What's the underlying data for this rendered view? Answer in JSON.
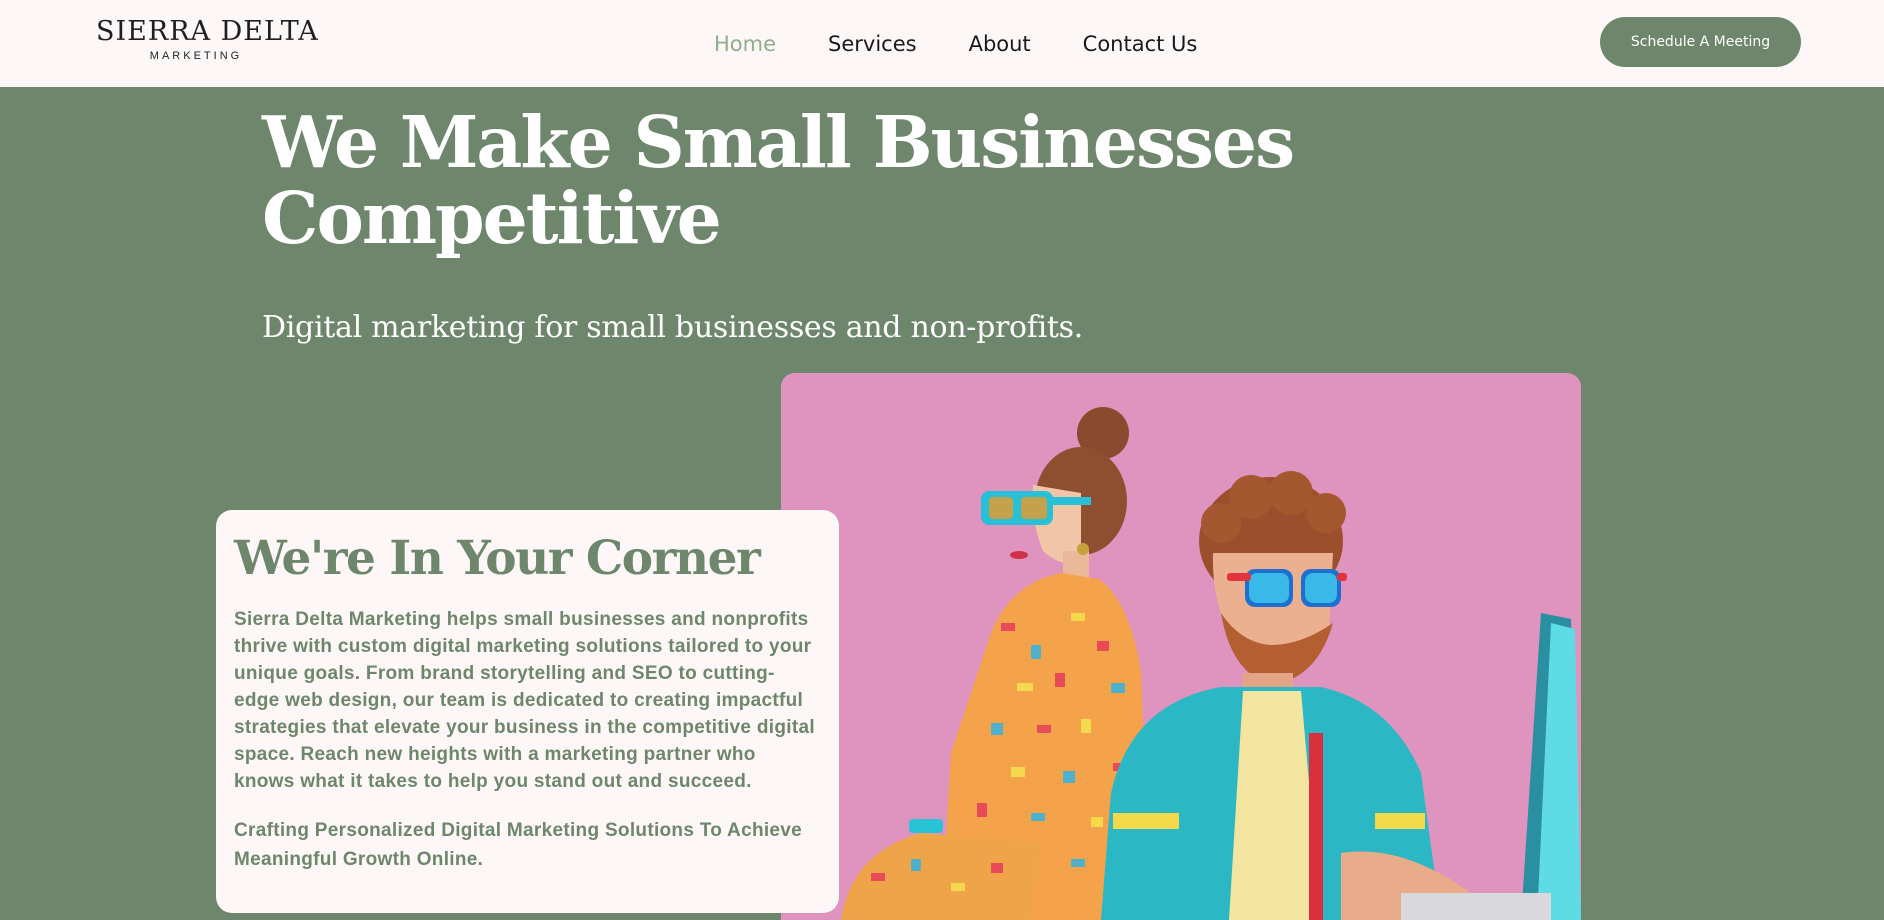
{
  "brand": {
    "logo_main": "SIERRA DELTA",
    "logo_sub": "MARKETING"
  },
  "nav": {
    "items": [
      {
        "label": "Home",
        "active": true
      },
      {
        "label": "Services",
        "active": false
      },
      {
        "label": "About",
        "active": false
      },
      {
        "label": "Contact Us",
        "active": false
      }
    ]
  },
  "header": {
    "cta_label": "Schedule A Meeting"
  },
  "hero": {
    "title": "We Make Small Businesses Competitive",
    "subtitle": "Digital marketing for small businesses and non-profits."
  },
  "card": {
    "heading": "We're In Your Corner",
    "body": "Sierra Delta Marketing helps small businesses and nonprofits thrive with custom digital marketing solutions tailored to your unique goals. From brand storytelling and SEO to cutting-edge web design, our team is dedicated to creating impactful strategies that elevate your business in the competitive digital space. Reach new heights with a marketing partner who knows what it takes to help you stand out and succeed.",
    "tagline": "Crafting Personalized Digital Marketing Solutions To Achieve Meaningful Growth Online."
  },
  "colors": {
    "brand_green": "#6e876c",
    "nav_active": "#8fae8c",
    "header_bg": "#fdf7f7",
    "photo_bg": "#de8fbd"
  }
}
